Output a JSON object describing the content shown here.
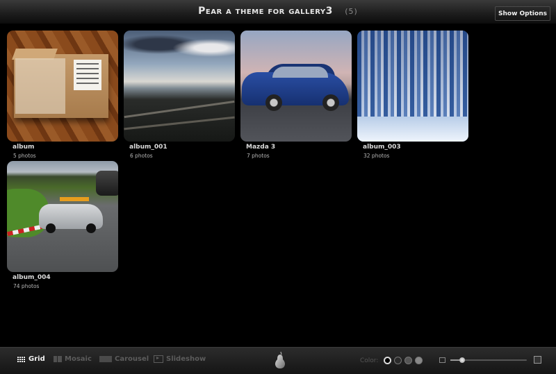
{
  "header": {
    "title": "Pear a theme for gallery3",
    "count": "(5)",
    "show_options_label": "Show Options"
  },
  "albums": [
    {
      "title": "album",
      "count": "5 photos",
      "thumb": "cardboard-box-on-parquet"
    },
    {
      "title": "album_001",
      "count": "6 photos",
      "thumb": "lake-view-from-balcony"
    },
    {
      "title": "Mazda 3",
      "count": "7 photos",
      "thumb": "blue-hatchback-car"
    },
    {
      "title": "album_003",
      "count": "32 photos",
      "thumb": "snowy-forest"
    },
    {
      "title": "album_004",
      "count": "74 photos",
      "thumb": "race-track-safety-car"
    }
  ],
  "toolbar": {
    "views": [
      {
        "label": "Grid",
        "icon": "grid-icon",
        "active": true
      },
      {
        "label": "Mosaic",
        "icon": "mosaic-icon",
        "active": false
      },
      {
        "label": "Carousel",
        "icon": "carousel-icon",
        "active": false
      },
      {
        "label": "Slideshow",
        "icon": "slideshow-icon",
        "active": false
      }
    ],
    "color_label": "Color:",
    "colors": [
      "#000000",
      "#2a2a2a",
      "#555555",
      "#888888"
    ],
    "selected_color": 0,
    "zoom_level": 0.15
  },
  "logo": "pear-icon"
}
